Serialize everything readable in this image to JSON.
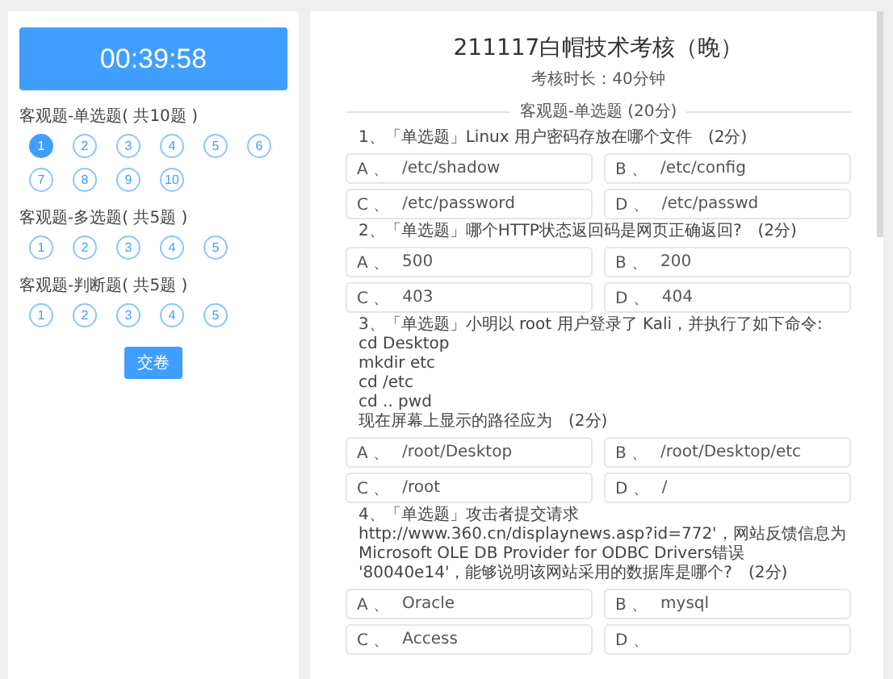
{
  "sidebar": {
    "timer": "00:39:58",
    "sections": [
      {
        "title": "客观题-单选题( 共10题 )",
        "items": [
          {
            "label": "1",
            "selected": true
          },
          {
            "label": "2",
            "selected": false
          },
          {
            "label": "3",
            "selected": false
          },
          {
            "label": "4",
            "selected": false
          },
          {
            "label": "5",
            "selected": false
          },
          {
            "label": "6",
            "selected": false
          },
          {
            "label": "7",
            "selected": false
          },
          {
            "label": "8",
            "selected": false
          },
          {
            "label": "9",
            "selected": false
          },
          {
            "label": "10",
            "selected": false
          }
        ]
      },
      {
        "title": "客观题-多选题( 共5题 )",
        "items": [
          {
            "label": "1",
            "selected": false
          },
          {
            "label": "2",
            "selected": false
          },
          {
            "label": "3",
            "selected": false
          },
          {
            "label": "4",
            "selected": false
          },
          {
            "label": "5",
            "selected": false
          }
        ]
      },
      {
        "title": "客观题-判断题( 共5题 )",
        "items": [
          {
            "label": "1",
            "selected": false
          },
          {
            "label": "2",
            "selected": false
          },
          {
            "label": "3",
            "selected": false
          },
          {
            "label": "4",
            "selected": false
          },
          {
            "label": "5",
            "selected": false
          }
        ]
      }
    ],
    "submit_button": "交卷"
  },
  "exam": {
    "title": "211117白帽技术考核（晚）",
    "duration": "考核时长：40分钟",
    "section_header": "客观题-单选题 (20分)",
    "questions": [
      {
        "lines": [
          "1、「单选题」Linux 用户密码存放在哪个文件　(2分)"
        ],
        "options": [
          {
            "letter": "A 、",
            "text": "/etc/shadow"
          },
          {
            "letter": "B 、",
            "text": "/etc/config"
          },
          {
            "letter": "C 、",
            "text": "/etc/password"
          },
          {
            "letter": "D 、",
            "text": "/etc/passwd"
          }
        ]
      },
      {
        "lines": [
          "2、「单选题」哪个HTTP状态返回码是网页正确返回?　(2分)"
        ],
        "options": [
          {
            "letter": "A 、",
            "text": "500"
          },
          {
            "letter": "B 、",
            "text": "200"
          },
          {
            "letter": "C 、",
            "text": "403"
          },
          {
            "letter": "D 、",
            "text": "404"
          }
        ]
      },
      {
        "lines": [
          "3、「单选题」小明以 root 用户登录了 Kali，并执行了如下命令:",
          "cd Desktop",
          "mkdir etc",
          "cd /etc",
          "cd .. pwd",
          "现在屏幕上显示的路径应为　(2分)"
        ],
        "options": [
          {
            "letter": "A 、",
            "text": "/root/Desktop"
          },
          {
            "letter": "B 、",
            "text": "/root/Desktop/etc"
          },
          {
            "letter": "C 、",
            "text": "/root"
          },
          {
            "letter": "D 、",
            "text": "/"
          }
        ]
      },
      {
        "lines": [
          "4、「单选题」攻击者提交请求 http://www.360.cn/displaynews.asp?id=772'，网站反馈信息为 Microsoft OLE DB Provider for ODBC Drivers错误 '80040e14'，能够说明该网站采用的数据库是哪个?　(2分)"
        ],
        "options": [
          {
            "letter": "A 、",
            "text": "Oracle"
          },
          {
            "letter": "B 、",
            "text": "mysql"
          },
          {
            "letter": "C 、",
            "text": "Access"
          },
          {
            "letter": "D 、"
          }
        ]
      }
    ]
  }
}
